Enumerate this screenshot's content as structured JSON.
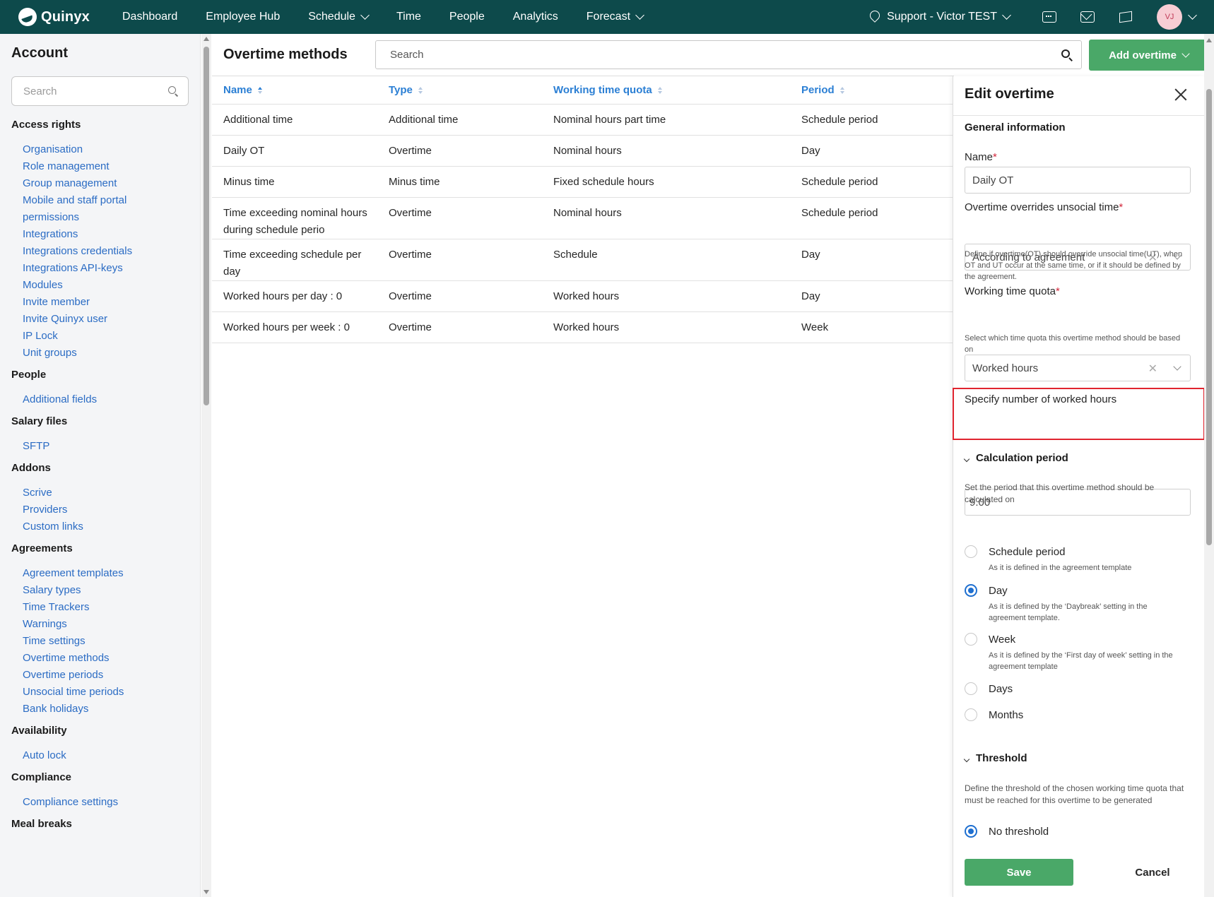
{
  "topnav": {
    "logo_text": "Quinyx",
    "items": [
      {
        "label": "Dashboard",
        "dropdown": false
      },
      {
        "label": "Employee Hub",
        "dropdown": false
      },
      {
        "label": "Schedule",
        "dropdown": true
      },
      {
        "label": "Time",
        "dropdown": false
      },
      {
        "label": "People",
        "dropdown": false
      },
      {
        "label": "Analytics",
        "dropdown": false
      },
      {
        "label": "Forecast",
        "dropdown": true
      }
    ],
    "location": "Support - Victor TEST",
    "avatar_initials": "VJ"
  },
  "sidebar": {
    "title": "Account",
    "search_placeholder": "Search",
    "groups": [
      {
        "heading": "Access rights",
        "items": [
          "Organisation",
          "Role management",
          "Group management",
          "Mobile and staff portal",
          "permissions",
          "Integrations",
          "Integrations credentials",
          "Integrations API-keys",
          "Modules",
          "Invite member",
          "Invite Quinyx user",
          "IP Lock",
          "Unit groups"
        ]
      },
      {
        "heading": "People",
        "items": [
          "Additional fields"
        ]
      },
      {
        "heading": "Salary files",
        "items": [
          "SFTP"
        ]
      },
      {
        "heading": "Addons",
        "items": [
          "Scrive",
          "Providers",
          "Custom links"
        ]
      },
      {
        "heading": "Agreements",
        "items": [
          "Agreement templates",
          "Salary types",
          "Time Trackers",
          "Warnings",
          "Time settings",
          "Overtime methods",
          "Overtime periods",
          "Unsocial time periods",
          "Bank holidays"
        ]
      },
      {
        "heading": "Availability",
        "items": [
          "Auto lock"
        ]
      },
      {
        "heading": "Compliance",
        "items": [
          "Compliance settings"
        ]
      },
      {
        "heading": "Meal breaks",
        "items": []
      }
    ]
  },
  "main": {
    "title": "Overtime methods",
    "search_placeholder": "Search",
    "add_button": "Add overtime",
    "columns": [
      "Name",
      "Type",
      "Working time quota",
      "Period"
    ],
    "rows": [
      [
        "Additional time",
        "Additional time",
        "Nominal hours part time",
        "Schedule period"
      ],
      [
        "Daily OT",
        "Overtime",
        "Nominal hours",
        "Day"
      ],
      [
        "Minus time",
        "Minus time",
        "Fixed schedule hours",
        "Schedule period"
      ],
      [
        "Time exceeding nominal hours during schedule perio",
        "Overtime",
        "Nominal hours",
        "Schedule period"
      ],
      [
        "Time exceeding schedule per day",
        "Overtime",
        "Schedule",
        "Day"
      ],
      [
        "Worked hours per day : 0",
        "Overtime",
        "Worked hours",
        "Day"
      ],
      [
        "Worked hours per week : 0",
        "Overtime",
        "Worked hours",
        "Week"
      ]
    ]
  },
  "panel": {
    "title": "Edit overtime",
    "general_heading": "General information",
    "name_label": "Name",
    "name_value": "Daily OT",
    "override_label": "Overtime overrides unsocial time",
    "override_value": "According to agreement",
    "override_help": "Define if overtime(OT) should override unsocial time(UT), when OT and UT occur at the same time, or if it should be defined by the agreement.",
    "quota_label": "Working time quota",
    "quota_value": "Worked hours",
    "quota_help": "Select which time quota this overtime method should be based on",
    "hours_label": "Specify number of worked hours",
    "hours_value": "9.00",
    "calc_heading": "Calculation period",
    "calc_help": "Set the period that this overtime method should be calculated on",
    "periods": [
      {
        "label": "Schedule period",
        "desc": "As it is defined in the agreement template",
        "selected": false
      },
      {
        "label": "Day",
        "desc": "As it is defined by the ‘Daybreak’ setting in the agreement template.",
        "selected": true
      },
      {
        "label": "Week",
        "desc": "As it is defined by the ‘First day of week’ setting in the agreement template",
        "selected": false
      },
      {
        "label": "Days",
        "desc": "",
        "selected": false
      },
      {
        "label": "Months",
        "desc": "",
        "selected": false
      }
    ],
    "threshold_heading": "Threshold",
    "threshold_help": "Define the threshold of the chosen working time quota that must be reached for this overtime to be generated",
    "threshold_option": "No threshold",
    "save": "Save",
    "cancel": "Cancel"
  }
}
